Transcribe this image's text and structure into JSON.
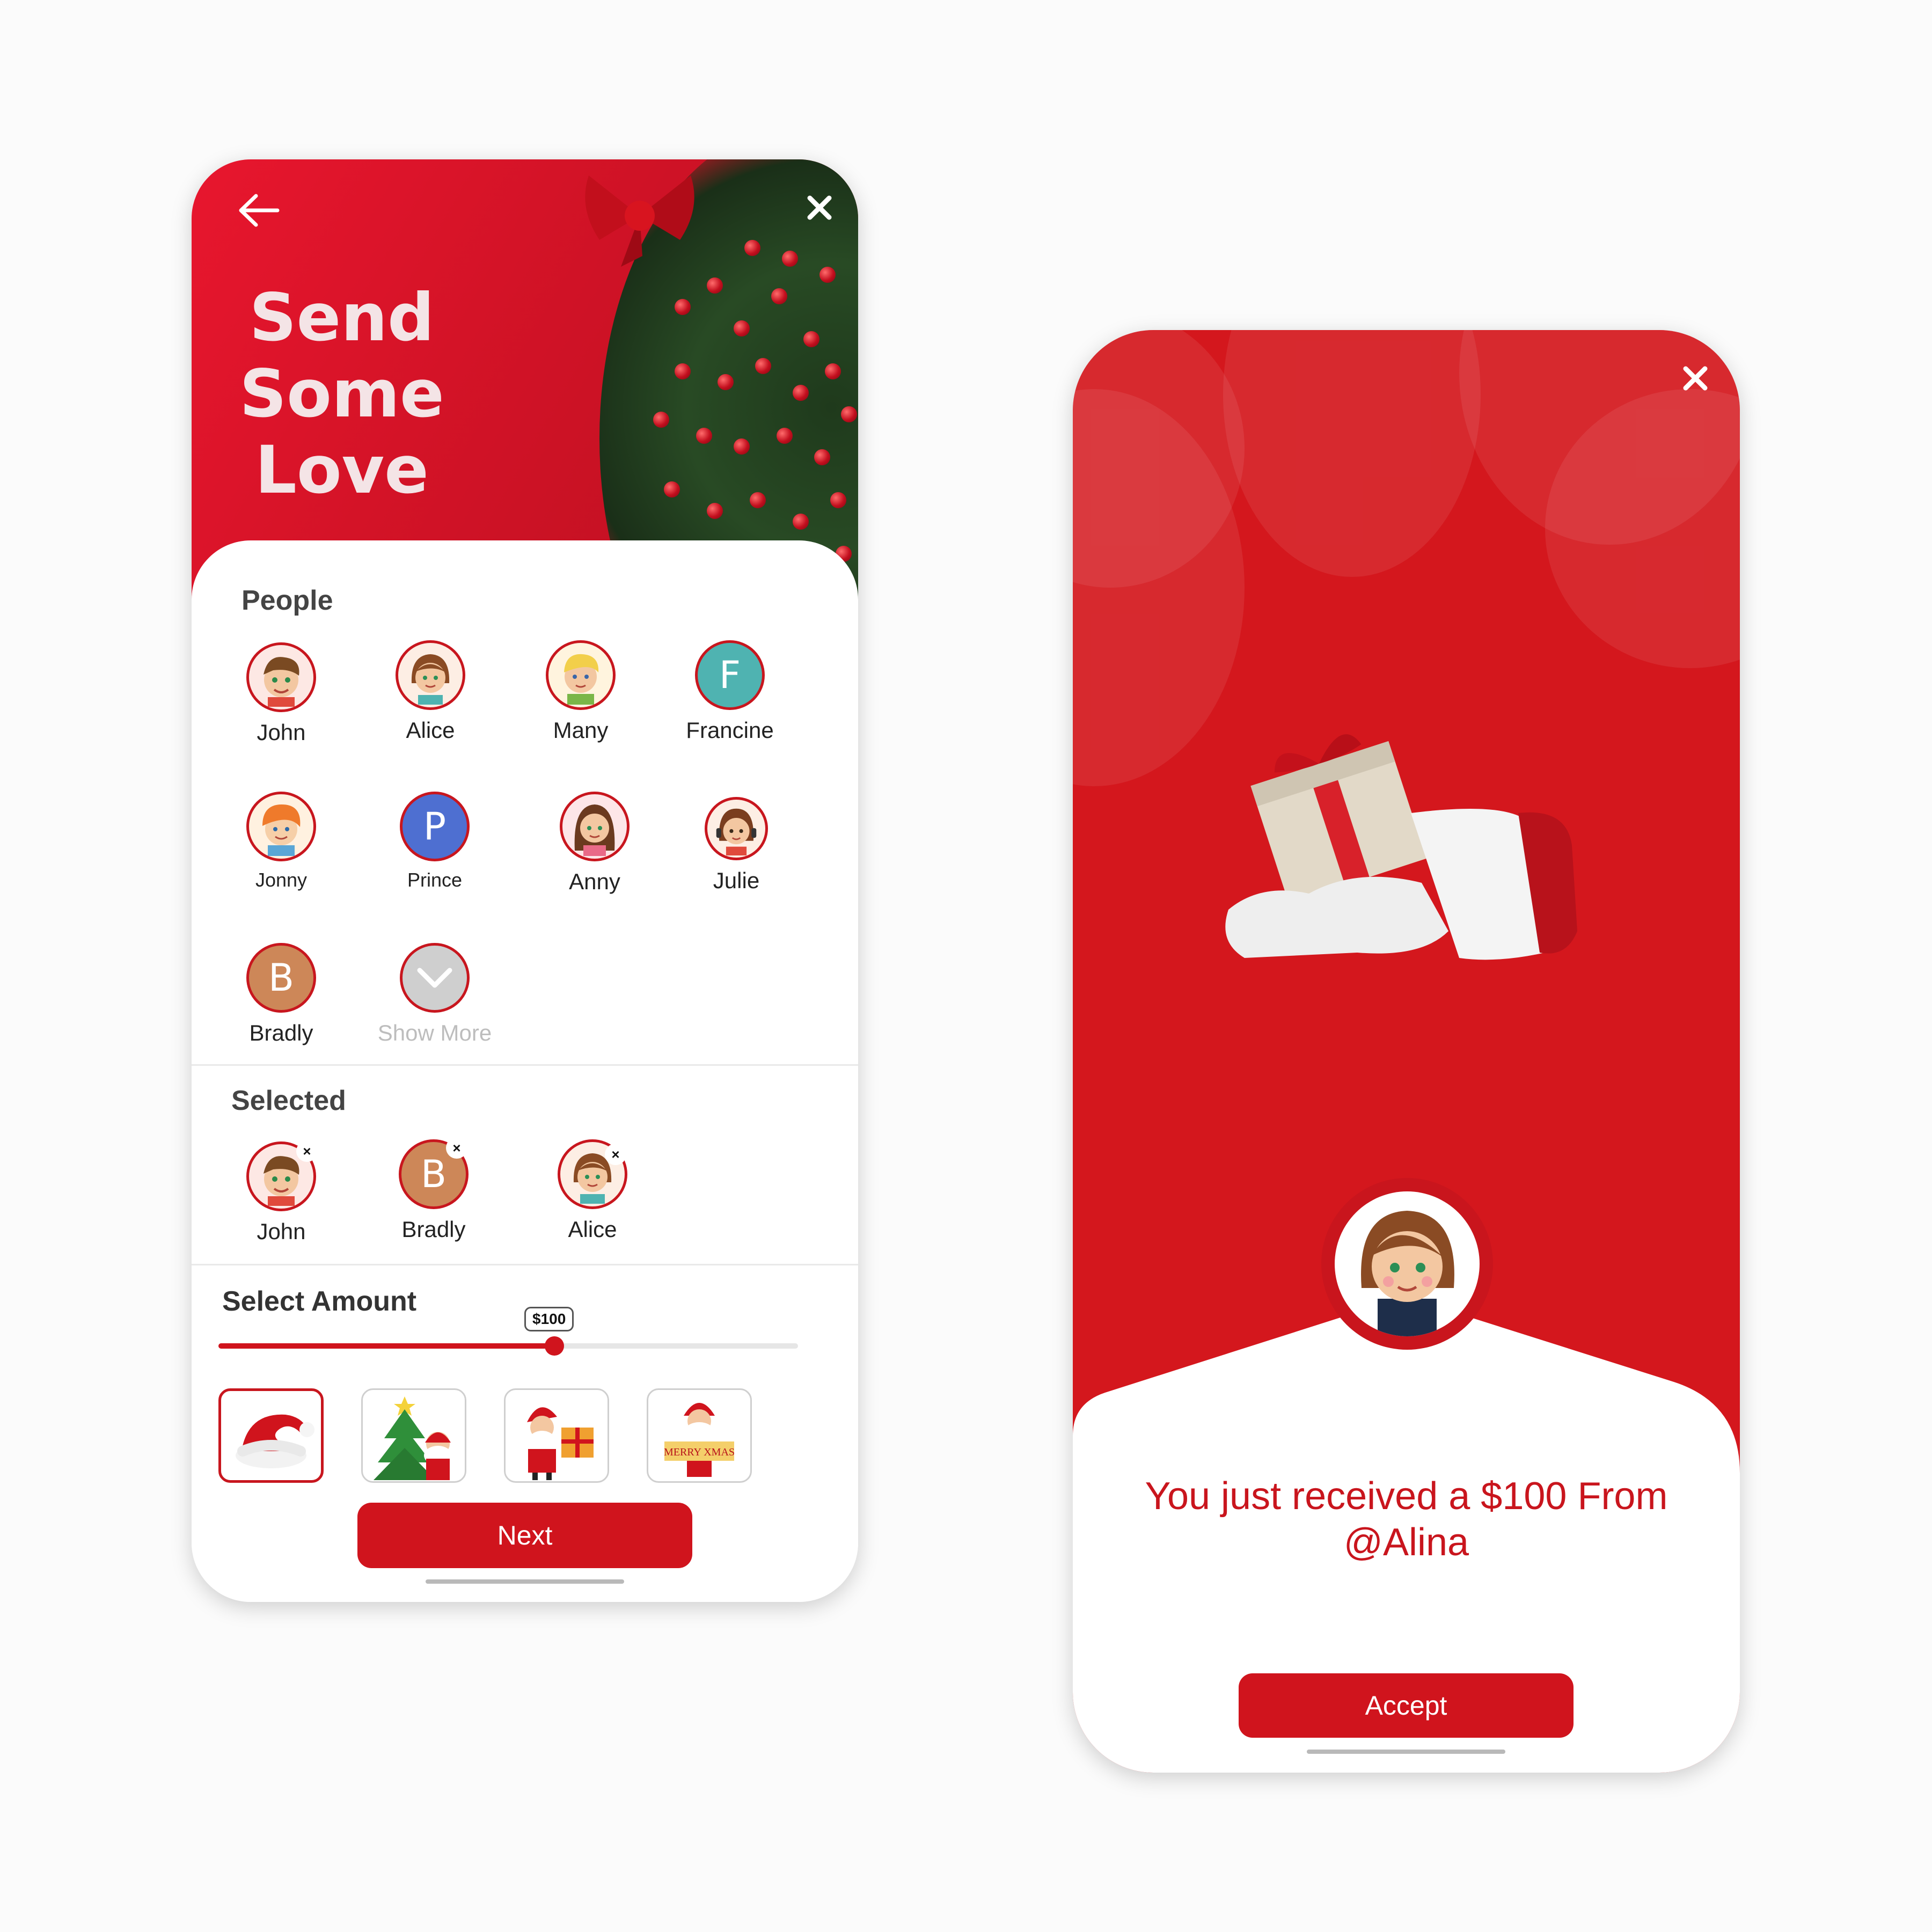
{
  "send_screen": {
    "title_lines": [
      "Send",
      "Some",
      "Love"
    ],
    "people_title": "People",
    "people": [
      {
        "name": "John",
        "type": "avatar",
        "icon": "boy-avatar-icon"
      },
      {
        "name": "Alice",
        "type": "avatar",
        "icon": "girl-avatar-icon"
      },
      {
        "name": "Many",
        "type": "avatar",
        "icon": "blond-boy-avatar-icon"
      },
      {
        "name": "Francine",
        "type": "letter",
        "letter": "F",
        "color": "#4fb3b1"
      },
      {
        "name": "Jonny",
        "type": "avatar",
        "icon": "redhead-boy-avatar-icon"
      },
      {
        "name": "Prince",
        "type": "letter",
        "letter": "P",
        "color": "#4e6fd1"
      },
      {
        "name": "Anny",
        "type": "avatar",
        "icon": "brunette-girl-avatar-icon"
      },
      {
        "name": "Julie",
        "type": "avatar",
        "icon": "headset-girl-avatar-icon"
      },
      {
        "name": "Bradly",
        "type": "letter",
        "letter": "B",
        "color": "#cd8758"
      }
    ],
    "show_more_label": "Show More",
    "selected_title": "Selected",
    "selected": [
      {
        "name": "John",
        "type": "avatar"
      },
      {
        "name": "Bradly",
        "type": "letter",
        "letter": "B",
        "color": "#cd8758"
      },
      {
        "name": "Alice",
        "type": "avatar"
      }
    ],
    "amount_title": "Select Amount",
    "amount_value": "$100",
    "amount_fraction": 0.58,
    "stickers": [
      {
        "icon": "santa-hat-icon",
        "selected": true
      },
      {
        "icon": "christmas-tree-santa-icon",
        "selected": false
      },
      {
        "icon": "santa-gift-icon",
        "selected": false
      },
      {
        "icon": "santa-merry-xmas-icon",
        "selected": false,
        "banner_text": "MERRY XMAS"
      }
    ],
    "next_label": "Next"
  },
  "receive_screen": {
    "message": "You just received a $100 From @Alina",
    "accept_label": "Accept"
  },
  "colors": {
    "brand_red": "#d0141d",
    "text_dark": "#444444",
    "muted": "#bdbdbd"
  }
}
